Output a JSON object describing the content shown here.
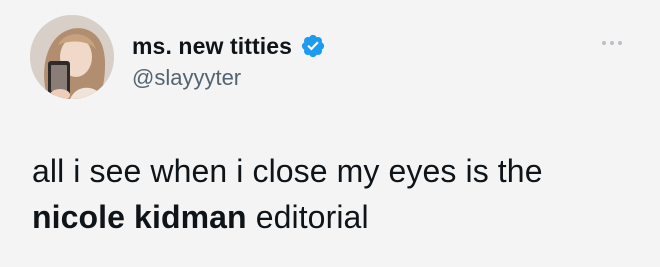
{
  "author": {
    "display_name": "ms. new titties",
    "handle": "@slayyyter",
    "verified": true,
    "avatar": "profile-photo"
  },
  "tweet": {
    "line1": "all i see when i close my eyes is the",
    "line2_bold": "nicole kidman",
    "line2_rest": " editorial"
  },
  "icons": {
    "verified": "verified-badge-icon",
    "more": "more-options-icon"
  },
  "colors": {
    "verified": "#1d9bf0",
    "text": "#0f1419",
    "secondary": "#536471",
    "background": "#f4f4f4"
  }
}
